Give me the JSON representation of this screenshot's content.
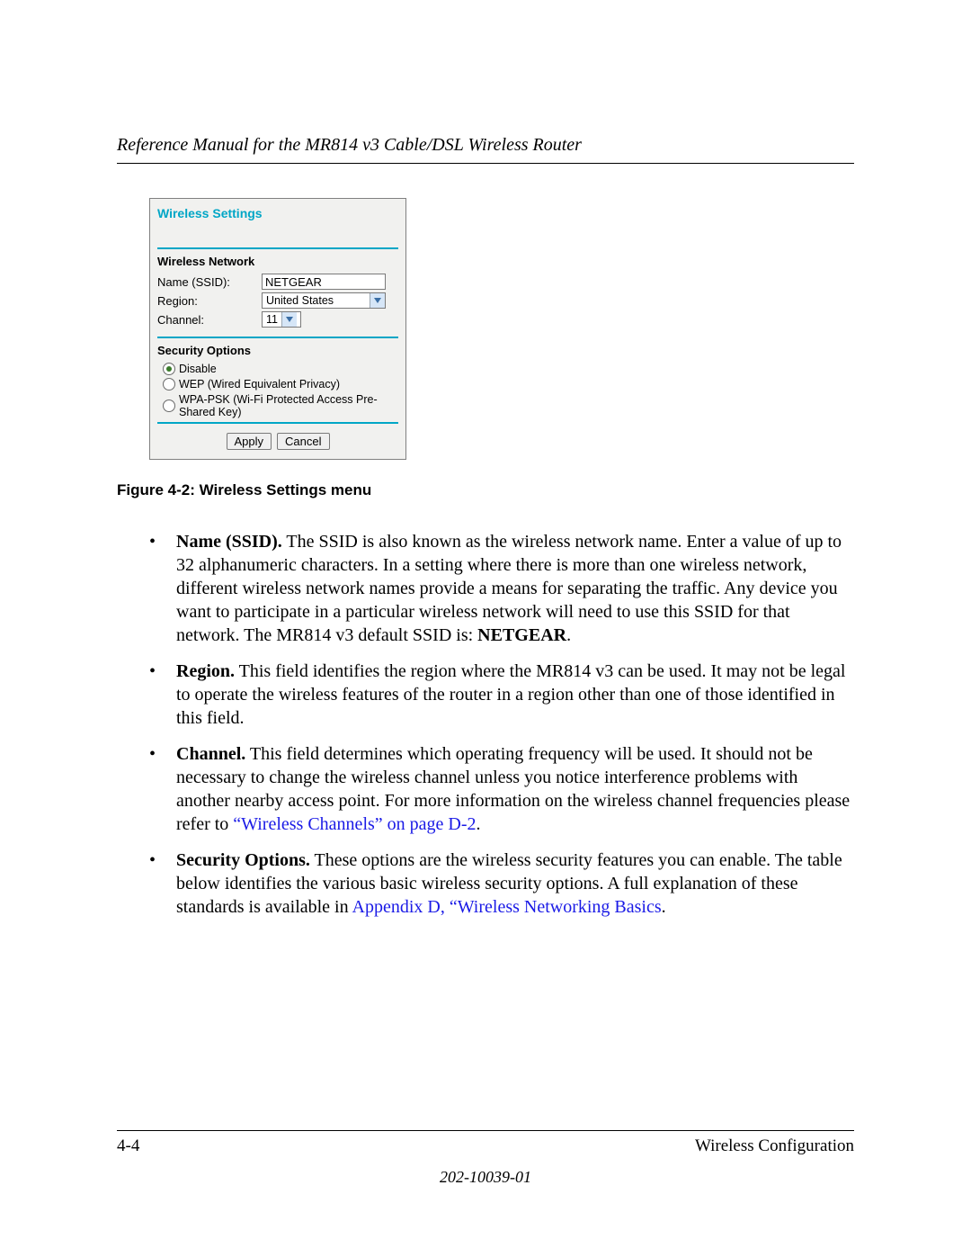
{
  "header": {
    "running_head": "Reference Manual for the MR814 v3 Cable/DSL Wireless Router"
  },
  "panel": {
    "title": "Wireless Settings",
    "network": {
      "heading": "Wireless Network",
      "ssid_label": "Name (SSID):",
      "ssid_value": "NETGEAR",
      "region_label": "Region:",
      "region_value": "United States",
      "channel_label": "Channel:",
      "channel_value": "11"
    },
    "security": {
      "heading": "Security Options",
      "opt_disable": "Disable",
      "opt_wep": "WEP (Wired Equivalent Privacy)",
      "opt_wpa": "WPA-PSK (Wi-Fi Protected Access Pre-Shared Key)"
    },
    "buttons": {
      "apply": "Apply",
      "cancel": "Cancel"
    }
  },
  "caption": "Figure 4-2:  Wireless Settings menu",
  "bullets": {
    "ssid": {
      "lead": "Name (SSID).",
      "text_a": " The SSID is also known as the wireless network name. Enter a value of up to 32 alphanumeric characters. In a setting where there is more than one wireless network, different wireless network names provide a means for separating the traffic. Any device you want to participate in a particular wireless network will need to use this SSID for that network. The MR814 v3 default SSID is: ",
      "default_ssid": "NETGEAR",
      "tail": "."
    },
    "region": {
      "lead": "Region.",
      "text": " This field identifies the region where the MR814 v3 can be used. It may not be legal to operate the wireless features of the router in a region other than one of those identified in this field."
    },
    "channel": {
      "lead": "Channel.",
      "text": " This field determines which operating frequency will be used. It should not be necessary to change the wireless channel unless you notice interference problems with another nearby access point. For more information on the wireless channel frequencies please refer to ",
      "link": "“Wireless Channels” on page D-2",
      "tail": "."
    },
    "security": {
      "lead": "Security Options.",
      "text": " These options are the wireless security features you can enable. The table below identifies the various basic wireless security options. A full explanation of these standards is available in ",
      "link": "Appendix D, “Wireless Networking Basics",
      "tail": "."
    }
  },
  "footer": {
    "page_num": "4-4",
    "section": "Wireless Configuration",
    "doc_num": "202-10039-01"
  }
}
